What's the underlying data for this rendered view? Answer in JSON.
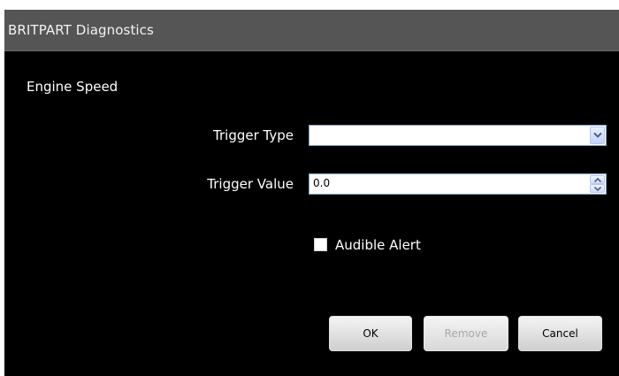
{
  "window": {
    "title": "BRITPART Diagnostics"
  },
  "form": {
    "section_title": "Engine Speed",
    "trigger_type": {
      "label": "Trigger Type",
      "value": ""
    },
    "trigger_value": {
      "label": "Trigger Value",
      "value": "0.0"
    },
    "audible_alert": {
      "label": "Audible Alert",
      "checked": false
    }
  },
  "buttons": {
    "ok_label": "OK",
    "remove_label": "Remove",
    "cancel_label": "Cancel",
    "remove_enabled": false
  },
  "colors": {
    "background": "#000000",
    "titlebar": "#555555",
    "text": "#ffffff",
    "disabled_text": "#a8a8a8"
  },
  "icons": {
    "dropdown": "chevron-down-icon",
    "spin_up": "spin-up-icon",
    "spin_down": "spin-down-icon"
  }
}
